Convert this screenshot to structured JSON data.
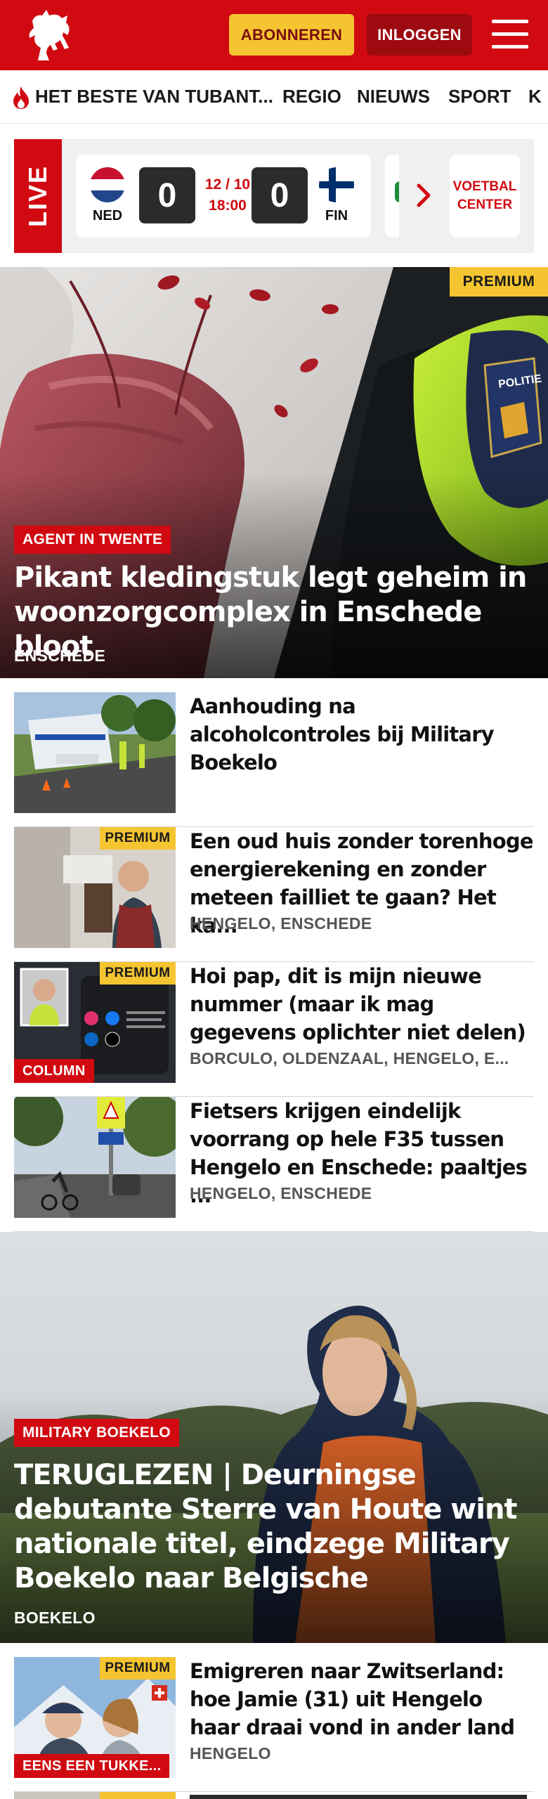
{
  "header": {
    "subscribe_label": "ABONNEREN",
    "login_label": "INLOGGEN",
    "brand_color": "#d10a11"
  },
  "nav": {
    "items": [
      "HET BESTE VAN TUBANT...",
      "REGIO",
      "NIEUWS",
      "SPORT",
      "K"
    ]
  },
  "live": {
    "label": "LIVE",
    "match": {
      "home_team": "NED",
      "away_team": "FIN",
      "home_score": "0",
      "away_score": "0",
      "date": "12 / 10",
      "time": "18:00"
    },
    "football_center_label": "VOETBAL CENTER"
  },
  "hero": {
    "premium_label": "PREMIUM",
    "kicker": "AGENT IN TWENTE",
    "title": "Pikant kledingstuk legt geheim in woonzorgcomplex in Enschede bloot",
    "location": "ENSCHEDE"
  },
  "articles": [
    {
      "title": "Aanhouding na alcoholcontroles bij Military Boekelo",
      "location": "",
      "premium": "",
      "kicker": ""
    },
    {
      "title": "Een oud huis zonder torenhoge energierekening en zonder meteen failliet te gaan? Het ka...",
      "location": "HENGELO, ENSCHEDE",
      "premium": "PREMIUM",
      "kicker": ""
    },
    {
      "title": "Hoi pap, dit is mijn nieuwe nummer (maar ik mag gegevens oplichter niet delen)",
      "location": "BORCULO, OLDENZAAL, HENGELO, E...",
      "premium": "PREMIUM",
      "kicker": "COLUMN"
    },
    {
      "title": "Fietsers krijgen eindelijk voorrang op hele F35 tussen Hengelo en Enschede: paaltjes ...",
      "location": "HENGELO, ENSCHEDE",
      "premium": "",
      "kicker": ""
    }
  ],
  "hero2": {
    "kicker": "MILITARY BOEKELO",
    "title": "TERUGLEZEN | Deurningse debutante Sterre van Houte wint nationale titel, eindzege Military Boekelo naar Belgische",
    "location": "BOEKELO"
  },
  "articles2": [
    {
      "title": "Emigreren naar Zwitserland: hoe Jamie (31) uit Hengelo haar draai vond in ander land",
      "location": "HENGELO",
      "premium": "PREMIUM",
      "kicker": "EENS EEN TUKKE..."
    }
  ]
}
